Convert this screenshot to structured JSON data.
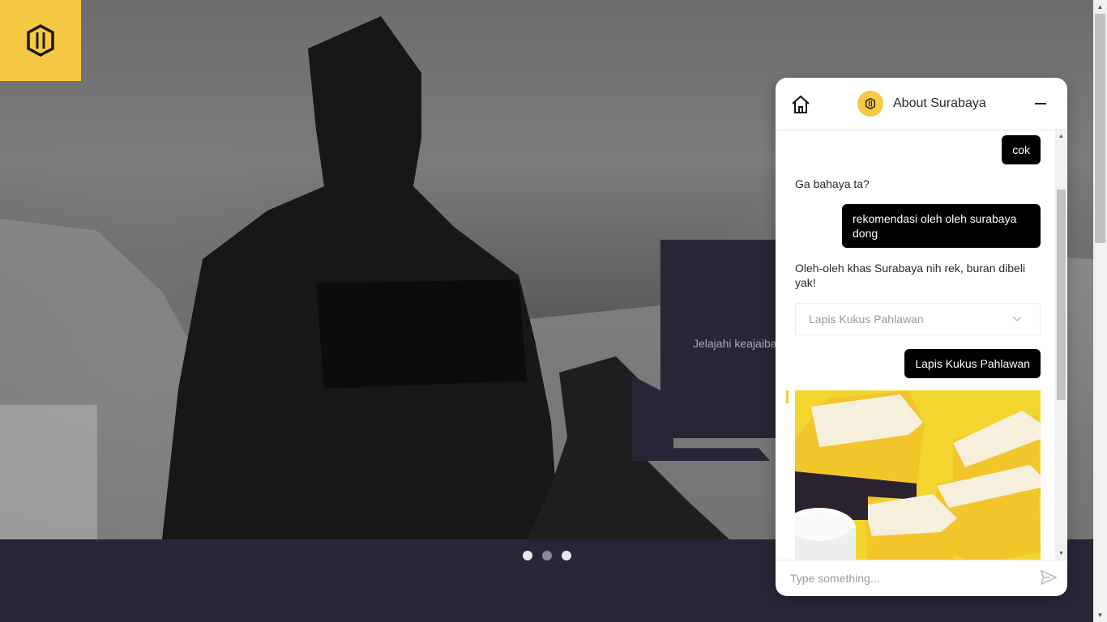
{
  "hero": {
    "promo_text": "Jelajahi keajaiban",
    "slides_total": 3,
    "active_slide": 2
  },
  "colors": {
    "brand_yellow": "#f6c944",
    "dark_navy": "#262637",
    "bubble_user": "#000000"
  },
  "chat": {
    "title": "About Surabaya",
    "home_icon": "home-icon",
    "minimize_icon": "minimize-icon",
    "messages": [
      {
        "from": "user",
        "text": "cok"
      },
      {
        "from": "bot",
        "text": "Ga bahaya ta?"
      },
      {
        "from": "user",
        "text": "rekomendasi oleh oleh surabaya dong"
      },
      {
        "from": "bot",
        "text": "Oleh-oleh khas Surabaya nih rek, buran dibeli yak!"
      },
      {
        "from": "user",
        "text": "Lapis Kukus Pahlawan"
      }
    ],
    "select": {
      "value": "Lapis Kukus Pahlawan"
    },
    "input": {
      "placeholder": "Type something..."
    },
    "send_icon": "send-icon"
  }
}
